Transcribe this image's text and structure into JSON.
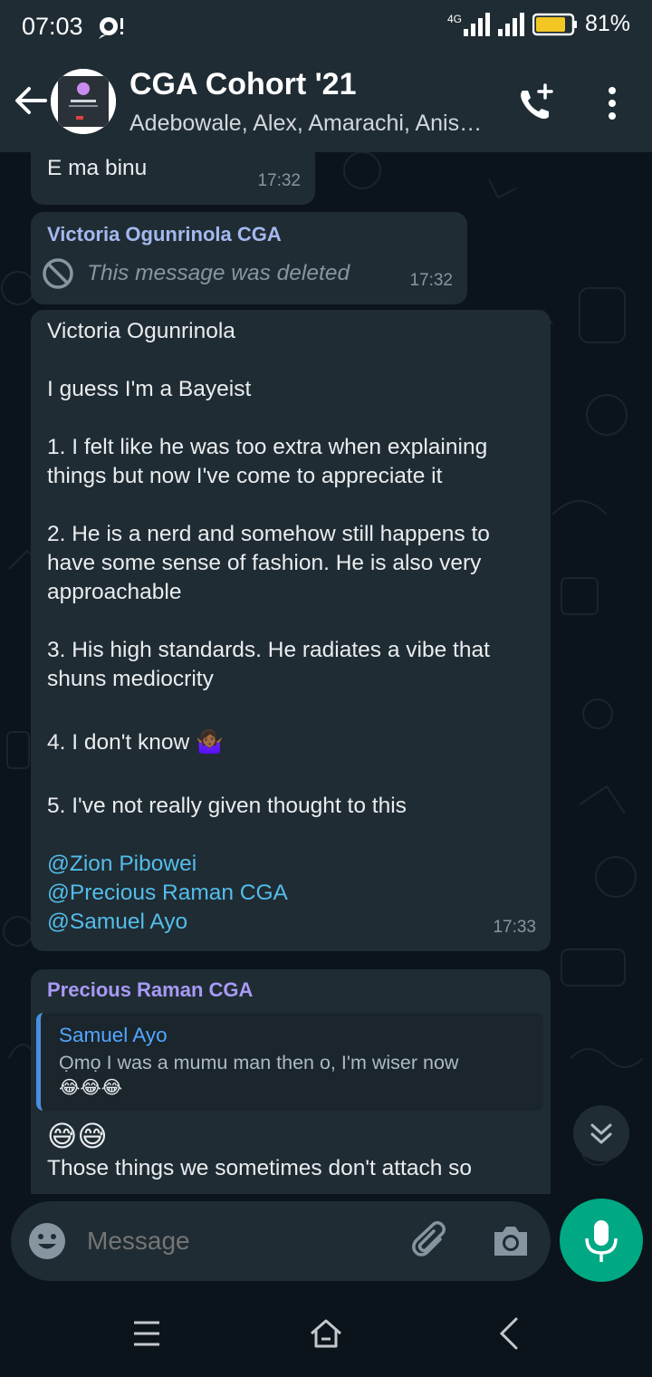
{
  "status_bar": {
    "time": "07:03",
    "network": "4G",
    "battery": "81%"
  },
  "header": {
    "title": "CGA Cohort '21",
    "members": "Adebowale, Alex, Amarachi, Anis…"
  },
  "messages": [
    {
      "text": "E ma binu",
      "time": "17:32"
    },
    {
      "sender": "Victoria Ogunrinola CGA",
      "sender_color": "#a4b8f0",
      "text": "This message was deleted",
      "time": "17:32"
    },
    {
      "lines": [
        "Victoria Ogunrinola",
        "I guess I'm a Bayeist",
        "1. I felt like he was too extra when explaining things but now I've come to appreciate it",
        "2. He is a nerd and somehow still happens to have some sense of fashion. He is also very approachable",
        "3. His high standards. He radiates a vibe that shuns mediocrity",
        "4. I don't know 🤷🏾‍♀️",
        "5. I've not really given thought to this"
      ],
      "mentions": [
        "@Zion Pibowei",
        "@Precious Raman CGA",
        "@Samuel Ayo"
      ],
      "time": "17:33"
    },
    {
      "sender": "Precious Raman CGA",
      "sender_color": "#a89af7",
      "quote_sender": "Samuel Ayo",
      "quote_sender_color": "#53a6ff",
      "quote_text": "Ọmọ I was a mumu man then o, I'm wiser now",
      "quote_emoji": "😂😂😂",
      "emoji": "😅😅",
      "text": "Those things we sometimes don't attach so"
    }
  ],
  "input": {
    "placeholder": "Message"
  },
  "icons": {
    "back": "back-arrow-icon",
    "call": "add-call-icon",
    "menu": "more-vert-icon",
    "emoji": "emoji-icon",
    "attach": "attach-icon",
    "camera": "camera-icon",
    "mic": "mic-icon"
  },
  "colors": {
    "accent": "#00a884",
    "bubble": "#202c33",
    "background": "#0b141a",
    "bar": "#1f2c34"
  }
}
